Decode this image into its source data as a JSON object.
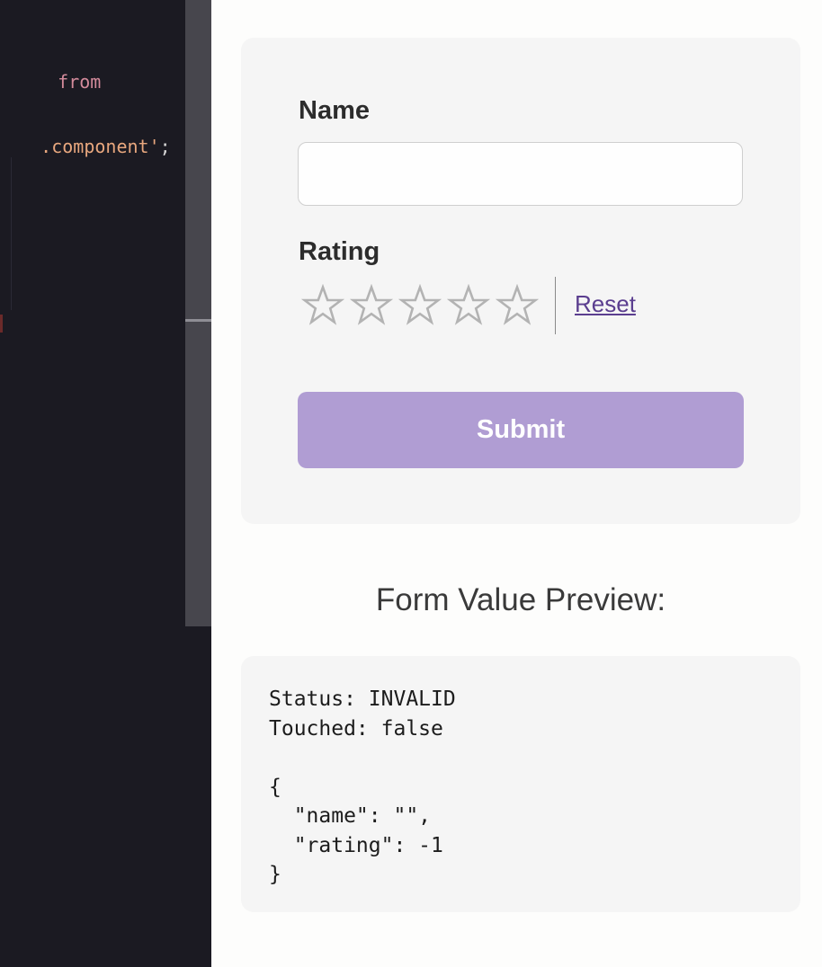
{
  "editor": {
    "lines": [
      {
        "parts": [
          {
            "text": "from",
            "kind": "kw"
          }
        ]
      },
      {
        "parts": [
          {
            "text": ".component'",
            "kind": "str"
          },
          {
            "text": ";",
            "kind": "punc"
          }
        ]
      }
    ]
  },
  "form": {
    "name_label": "Name",
    "name_value": "",
    "name_placeholder": "",
    "rating_label": "Rating",
    "rating": {
      "value": -1,
      "max": 5,
      "empty_color": "#b3b3b3",
      "icon": "star-outline-icon"
    },
    "reset_label": "Reset",
    "submit_label": "Submit",
    "submit_color": "#b09dd3"
  },
  "preview": {
    "title": "Form Value Preview:",
    "content": "Status: INVALID\nTouched: false\n\n{\n  \"name\": \"\",\n  \"rating\": -1\n}"
  }
}
